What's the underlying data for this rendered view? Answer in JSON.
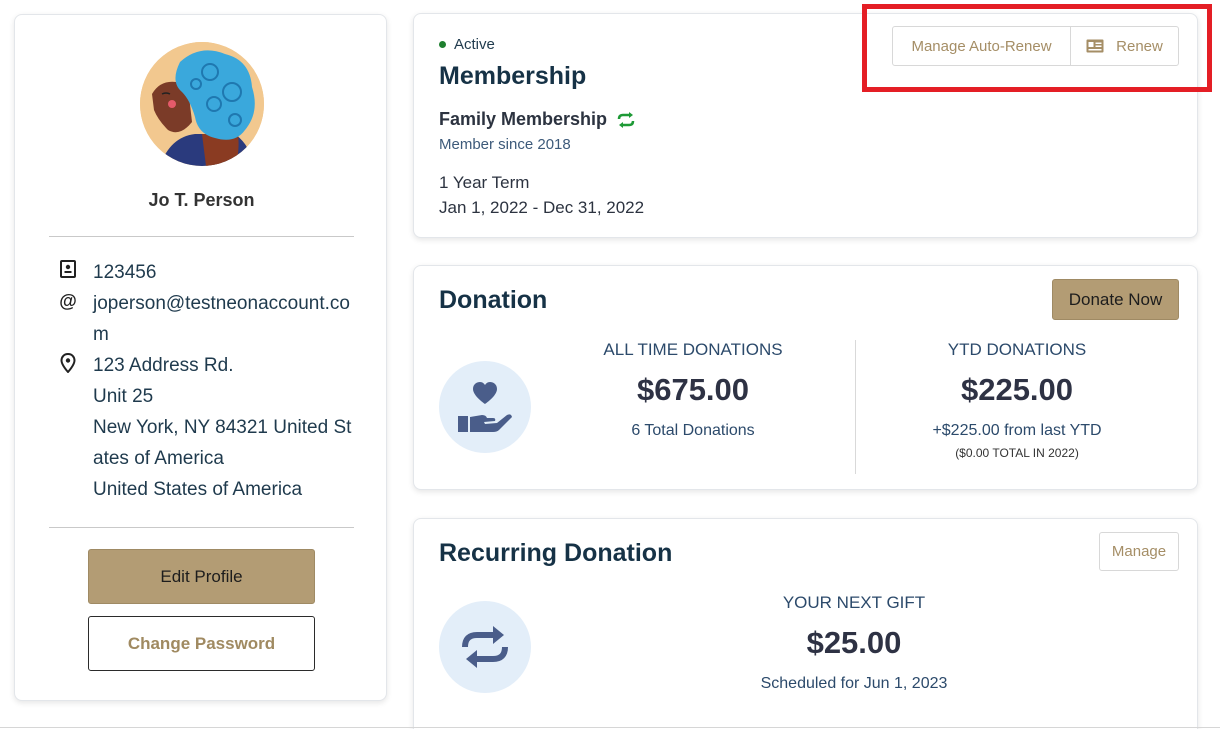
{
  "profile": {
    "name": "Jo T. Person",
    "account_id": "123456",
    "email": "joperson@testneonaccount.com",
    "address": "123 Address Rd.\nUnit 25\nNew York, NY 84321 United States of America\nUnited States of America",
    "address_lines": [
      "123 Address Rd.",
      "Unit 25",
      "New York, NY 84321 United States of America",
      "United States of America"
    ],
    "edit_label": "Edit Profile",
    "password_label": "Change Password"
  },
  "membership": {
    "status": "Active",
    "title": "Membership",
    "type": "Family Membership",
    "since": "Member since 2018",
    "term": "1 Year Term",
    "dates": "Jan 1, 2022 - Dec 31, 2022",
    "manage_autorenew_label": "Manage Auto-Renew",
    "renew_label": "Renew"
  },
  "donation": {
    "title": "Donation",
    "donate_label": "Donate Now",
    "all_time_label": "ALL TIME DONATIONS",
    "all_time_value": "$675.00",
    "all_time_count": "6 Total Donations",
    "ytd_label": "YTD DONATIONS",
    "ytd_value": "$225.00",
    "ytd_change": "+$225.00 from last YTD",
    "ytd_note": "($0.00 TOTAL IN 2022)"
  },
  "recurring": {
    "title": "Recurring Donation",
    "manage_label": "Manage",
    "next_label": "YOUR NEXT GIFT",
    "next_value": "$25.00",
    "scheduled": "Scheduled for Jun 1, 2023"
  },
  "colors": {
    "accent_gold": "#b39c74",
    "link_gold": "#a58e66",
    "active_green": "#1e7f2f",
    "highlight_red": "#e41e25",
    "icon_blue_bg": "#e3eef9",
    "icon_blue": "#4a5d8a"
  }
}
